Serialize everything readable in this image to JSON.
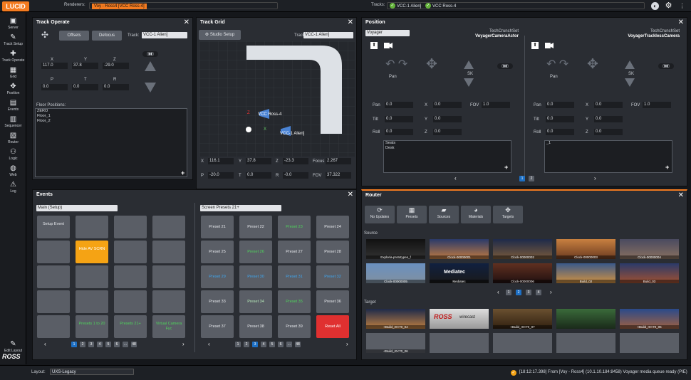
{
  "app": {
    "logo": "LUCID",
    "renderers_label": "Renderers:",
    "renderer_value": "Voy - Ross4 [VCC Ross-4]",
    "tracks_label": "Tracks:",
    "track_a": "VCC-1 Alien]",
    "track_b": "VCC Ross-4"
  },
  "sidebar": {
    "items": [
      {
        "label": "Server",
        "icon": "server-icon",
        "glyph": "▣"
      },
      {
        "label": "Track Setup",
        "icon": "wrench-icon",
        "glyph": "✎"
      },
      {
        "label": "Track Operate",
        "icon": "track-operate-icon",
        "glyph": "✚"
      },
      {
        "label": "Grid",
        "icon": "grid-icon",
        "glyph": "▦"
      },
      {
        "label": "Position",
        "icon": "position-icon",
        "glyph": "✥"
      },
      {
        "label": "Events",
        "icon": "events-icon",
        "glyph": "▤"
      },
      {
        "label": "Sequencer",
        "icon": "sequencer-icon",
        "glyph": "▥"
      },
      {
        "label": "Router",
        "icon": "router-icon",
        "glyph": "▧"
      },
      {
        "label": "Logic",
        "icon": "logic-icon",
        "glyph": "⚇"
      },
      {
        "label": "Web",
        "icon": "web-icon",
        "glyph": "◍"
      },
      {
        "label": "Log",
        "icon": "log-icon",
        "glyph": "⚠"
      }
    ],
    "edit_layout": "Edit Layout",
    "brand": "ROSS"
  },
  "track_operate": {
    "title": "Track Operate",
    "offsets": "Offsets",
    "defocus": "Defocus",
    "track_label": "Track:",
    "track_value": "VCC-1 Alien]",
    "x_label": "X",
    "y_label": "Y",
    "z_label": "Z",
    "x": "117.0",
    "y": "37.8",
    "z": "-29.0",
    "p_label": "P",
    "t_label": "T",
    "r_label": "R",
    "p": "0.0",
    "t": "0.0",
    "r": "0.0",
    "floor_label": "Floor Positions:",
    "floor_items": [
      "ZERO",
      "Floor_1",
      "Floor_2"
    ]
  },
  "track_grid": {
    "title": "Track Grid",
    "studio_setup": "Studio Setup",
    "track_label": "Track:",
    "track_value": "VCC-1 Alien]",
    "cam_a": "VCC Ross-4",
    "cam_b": "VCC-1 Alien]",
    "axis_x": "X",
    "axis_z": "Z",
    "x_label": "X",
    "x": "116.1",
    "y_label": "Y",
    "y": "37.8",
    "z_label": "Z",
    "z": "-23.3",
    "focus_label": "Focus",
    "focus": "2.267",
    "p_label": "P",
    "p": "-20.0",
    "t_label": "T",
    "t": "0.0",
    "r_label": "R",
    "r": "-0.0",
    "fov_label": "FOV",
    "fov": "37.322"
  },
  "position": {
    "title": "Position",
    "dropdown": "Voyager",
    "left": {
      "subtitle": "TechCrunchSet",
      "name": "VoyagerCameraActor",
      "pan": "Pan",
      "sk": "SK",
      "pan_v": "0.0",
      "tilt_v": "0.0",
      "roll_v": "0.0",
      "x": "0.0",
      "y": "0.0",
      "z": "0.0",
      "fov": "1.0",
      "list": [
        "Seats",
        "Desk"
      ]
    },
    "right": {
      "subtitle": "TechCrunchSet",
      "name": "VoyagerTracklessCamera",
      "pan": "Pan",
      "sk": "SK",
      "pan_v": "0.0",
      "tilt_v": "0.0",
      "roll_v": "0.0",
      "x": "0.0",
      "y": "0.0",
      "z": "0.0",
      "fov": "1.0",
      "list": [
        "_1"
      ]
    },
    "labels": {
      "pan": "Pan",
      "tilt": "Tilt",
      "roll": "Roll",
      "x": "X",
      "y": "Y",
      "z": "Z",
      "fov": "FOV"
    },
    "pages": [
      "1",
      "2"
    ]
  },
  "events": {
    "title": "Events",
    "dropdown_left": "Main (Setup)",
    "dropdown_right": "Screen Presets 21+",
    "left_tiles": [
      "Setup Event",
      "",
      "",
      "",
      "",
      "Hide AV SCRN",
      "",
      "",
      "",
      "",
      "",
      "",
      "",
      "",
      "",
      "",
      "",
      "Presets 1 to 20",
      "Presets 21+",
      "Virtual Camera Fyc"
    ],
    "right_tiles": [
      "Preset 21",
      "Preset 22",
      "Preset 23",
      "Preset 24",
      "Preset 25",
      "Preset 26",
      "Preset 27",
      "Preset 28",
      "Preset 29",
      "Preset 30",
      "Preset 31",
      "Preset 32",
      "Preset 33",
      "Preset 34",
      "Preset 35",
      "Preset 36",
      "Preset 37",
      "Preset 38",
      "Preset 39",
      "Reset All"
    ],
    "pages_left": [
      "1",
      "2",
      "3",
      "4",
      "5",
      "6",
      "...",
      "48"
    ],
    "pages_right": [
      "1",
      "2",
      "3",
      "4",
      "5",
      "6",
      "...",
      "48"
    ]
  },
  "router": {
    "title": "Router",
    "buttons": [
      "No Updates",
      "Presets",
      "Sources",
      "Materials",
      "Targets"
    ],
    "source_label": "Source",
    "target_label": "Target",
    "sources": [
      "Exploria-prototypes_f",
      "Clock-00000001",
      "Clock-00000002",
      "Clock-00000003",
      "Clock-00000004",
      "Clock-00000005",
      "Mediatec",
      "Clock-00000006",
      "Build_02",
      "Build_03"
    ],
    "source_brand": "Mediatec",
    "targets": [
      "<Build_r0<70_04",
      "",
      "",
      "<Build_r0<70_07",
      "<Build_r0<70_05",
      "<Build_r0<70_06"
    ],
    "target_brand": "ROSS",
    "target_brand2": "wirecast",
    "pages": [
      "1",
      "2",
      "3",
      "4"
    ]
  },
  "bottombar": {
    "layout_label": "Layout:",
    "layout_value": "UXS-Legacy",
    "status": "[18:12:17.398] From [Voy - Ross4] (10.1.10.184:8458) Voyager media queue ready (PIE)"
  },
  "colors": {
    "accent": "#f47b20",
    "active_page": "#1d6fc4",
    "green_text": "#4fd35c",
    "blue_text": "#3fa7f0",
    "yellow_tile": "#f5a314",
    "red_tile": "#e03030"
  }
}
